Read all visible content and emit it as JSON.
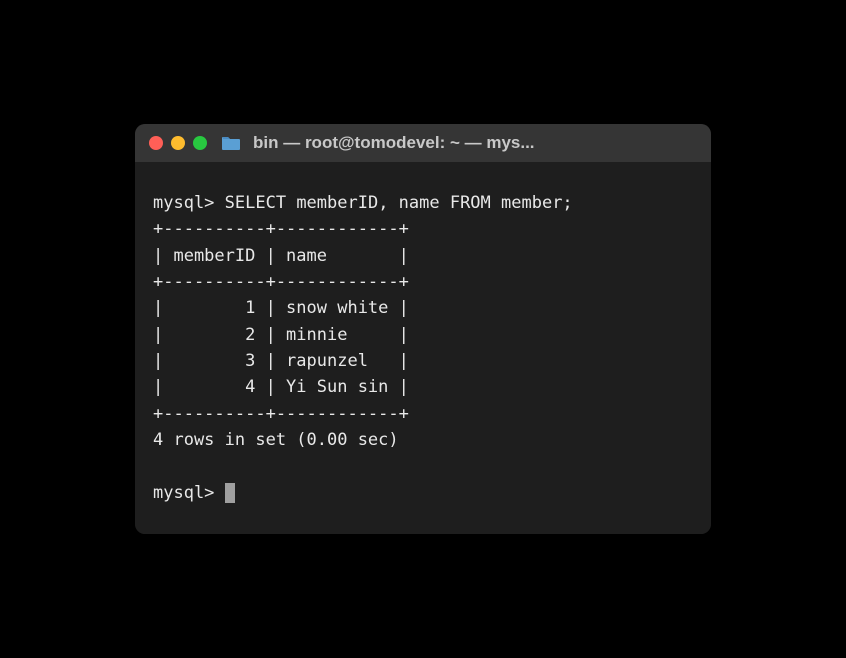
{
  "window": {
    "title": "bin — root@tomodevel: ~ — mys..."
  },
  "terminal": {
    "prompt": "mysql>",
    "query": "SELECT memberID, name FROM member;",
    "border_top": "+----------+------------+",
    "header_row": "| memberID | name       |",
    "border_mid": "+----------+------------+",
    "rows": [
      "|        1 | snow white |",
      "|        2 | minnie     |",
      "|        3 | rapunzel   |",
      "|        4 | Yi Sun sin |"
    ],
    "border_bot": "+----------+------------+",
    "status": "4 rows in set (0.00 sec)",
    "prompt2": "mysql> "
  },
  "chart_data": {
    "type": "table",
    "title": "",
    "columns": [
      "memberID",
      "name"
    ],
    "rows": [
      {
        "memberID": 1,
        "name": "snow white"
      },
      {
        "memberID": 2,
        "name": "minnie"
      },
      {
        "memberID": 3,
        "name": "rapunzel"
      },
      {
        "memberID": 4,
        "name": "Yi Sun sin"
      }
    ]
  }
}
